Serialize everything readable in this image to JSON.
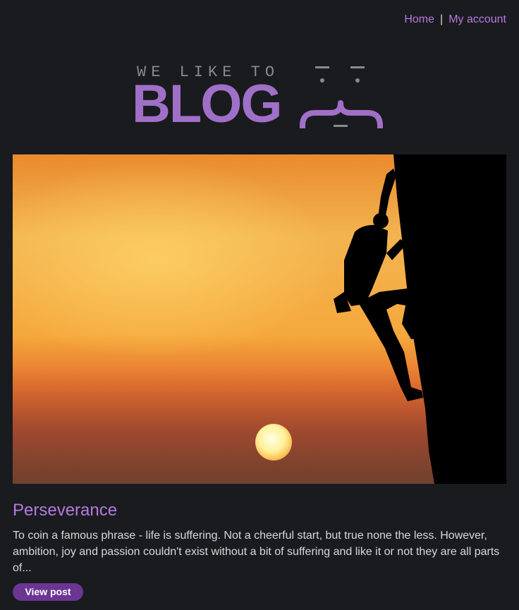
{
  "nav": {
    "home_label": "Home",
    "separator": "|",
    "account_label": "My account"
  },
  "logo": {
    "tagline": "WE LIKE TO",
    "word": "BLOG",
    "face_icon": "emoticon-face-icon"
  },
  "post": {
    "image_icon": "sunset-climber-image",
    "title": "Perseverance",
    "excerpt": "To coin a famous phrase - life is suffering. Not a cheerful start, but true none the less. However, ambition, joy and passion couldn't exist without a bit of suffering and like it or not they are all parts of...",
    "button_label": "View post"
  },
  "colors": {
    "background": "#1a1b1f",
    "accent": "#b57be0",
    "logo": "#a070c8",
    "button": "#6b3593",
    "text": "#d9d9d9"
  }
}
